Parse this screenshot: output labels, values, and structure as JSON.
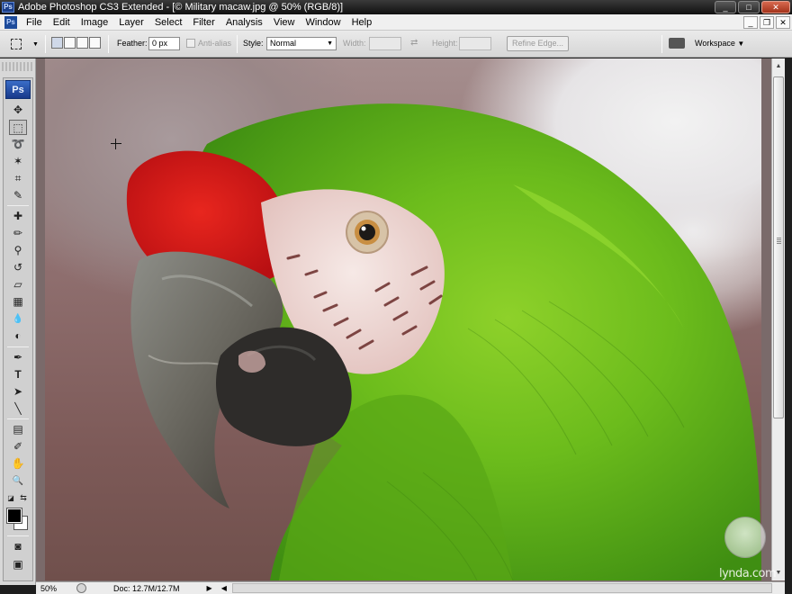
{
  "window": {
    "ps_icon": "Ps",
    "title": "Adobe Photoshop CS3 Extended - [© Military macaw.jpg @ 50% (RGB/8)]",
    "buttons": {
      "minimize": "_",
      "maximize": "□",
      "close": "✕"
    }
  },
  "menubar": {
    "items": [
      "File",
      "Edit",
      "Image",
      "Layer",
      "Select",
      "Filter",
      "Analysis",
      "View",
      "Window",
      "Help"
    ],
    "doc_buttons": {
      "minimize": "_",
      "restore": "❐",
      "close": "✕"
    }
  },
  "options": {
    "feather_label": "Feather:",
    "feather_value": "0 px",
    "antialias_label": "Anti-alias",
    "style_label": "Style:",
    "style_value": "Normal",
    "width_label": "Width:",
    "height_label": "Height:",
    "refine_edge_label": "Refine Edge...",
    "workspace_label": "Workspace"
  },
  "tools": {
    "ps_badge": "Ps",
    "icons": [
      {
        "name": "move-tool-icon",
        "glyph": "✥"
      },
      {
        "name": "rectangular-marquee-tool-icon",
        "glyph": "⬚"
      },
      {
        "name": "lasso-tool-icon",
        "glyph": "➰"
      },
      {
        "name": "magic-wand-tool-icon",
        "glyph": "✶"
      },
      {
        "name": "crop-tool-icon",
        "glyph": "⌗"
      },
      {
        "name": "eyedropper-tool-icon",
        "glyph": "✎"
      },
      {
        "name": "healing-brush-tool-icon",
        "glyph": "✚"
      },
      {
        "name": "brush-tool-icon",
        "glyph": "✏"
      },
      {
        "name": "clone-stamp-tool-icon",
        "glyph": "⚲"
      },
      {
        "name": "history-brush-tool-icon",
        "glyph": "↺"
      },
      {
        "name": "eraser-tool-icon",
        "glyph": "▱"
      },
      {
        "name": "gradient-tool-icon",
        "glyph": "▦"
      },
      {
        "name": "blur-tool-icon",
        "glyph": "💧"
      },
      {
        "name": "dodge-tool-icon",
        "glyph": "◐"
      },
      {
        "name": "pen-tool-icon",
        "glyph": "✒"
      },
      {
        "name": "type-tool-icon",
        "glyph": "T"
      },
      {
        "name": "path-selection-tool-icon",
        "glyph": "➤"
      },
      {
        "name": "line-tool-icon",
        "glyph": "╲"
      },
      {
        "name": "notes-tool-icon",
        "glyph": "▤"
      },
      {
        "name": "color-sampler-tool-icon",
        "glyph": "✐"
      },
      {
        "name": "hand-tool-icon",
        "glyph": "✋"
      },
      {
        "name": "zoom-tool-icon",
        "glyph": "🔍"
      }
    ],
    "active_tool": "rectangular-marquee-tool-icon"
  },
  "statusbar": {
    "zoom": "50%",
    "doc_size": "Doc: 12.7M/12.7M"
  },
  "watermark": {
    "text": "lynda.com"
  },
  "colors": {
    "foreground": "#000000",
    "background": "#ffffff",
    "accent_blue": "#1d4b9b"
  }
}
